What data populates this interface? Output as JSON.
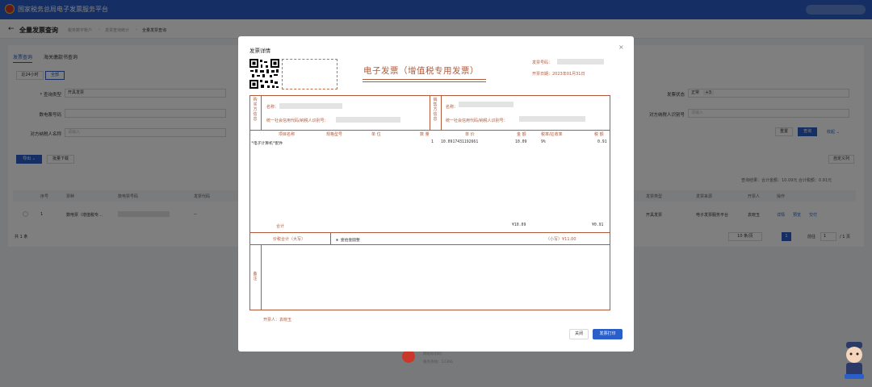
{
  "app": {
    "title": "国家税务总局电子发票服务平台"
  },
  "header": {
    "back_label": "←",
    "page_title": "全量发票查询",
    "breadcrumbs": [
      "税务数字账户",
      "发票查询统计",
      "全量发票查询"
    ]
  },
  "tabs": [
    "发票查询",
    "海关缴款书查询"
  ],
  "time_filters": [
    "近24小时",
    "全部"
  ],
  "filters": {
    "query_type_label": "* 查询类型",
    "query_type_value": "开具发票",
    "invoice_number_label": "数电票号码",
    "buyer_name_label": "对方纳税人名称",
    "buyer_name_placeholder": "请输入",
    "status_label": "发票状态",
    "status_value": "正常",
    "status_extra": "+3",
    "taxpayer_id_label": "对方纳税人识别号",
    "taxpayer_id_placeholder": "请输入",
    "reset_label": "重置",
    "search_label": "查询",
    "collapse_label": "收起 ⌄"
  },
  "toolbar": {
    "export_label": "导出 ⌄",
    "batch_download_label": "批量下载",
    "custom_columns_label": "自定义列"
  },
  "summary": "查询结果：合计金额：10.09元    合计税额：0.91元",
  "table": {
    "headers": [
      "序号",
      "票种",
      "数电票号码",
      "发票代码",
      "发票类型",
      "发票来源",
      "开票人",
      "操作"
    ],
    "rows": [
      {
        "index": "1",
        "type": "数电票（增值税专…",
        "code": "--",
        "invoice_type": "开具发票",
        "source": "电子发票服务平台",
        "issuer": "袁晓玉",
        "actions": [
          "详情",
          "预览",
          "交付"
        ]
      }
    ],
    "total": "共 1 条",
    "page_size": "10 条/页",
    "current_page": "1",
    "goto_label": "前往",
    "goto_value": "1",
    "page_total": "/ 1 页"
  },
  "footer": {
    "line1": "网站标识码：",
    "line2": "服务热线：12366"
  },
  "modal": {
    "title": "发票详情",
    "close_label": "×",
    "invoice_title": "电子发票（增值税专用发票）",
    "invoice_number_label": "发票号码：",
    "issue_date": "开票日期：2023年01月31日",
    "buyer_side": "购买方信息",
    "seller_side": "销售方信息",
    "buyer_name_label": "名称：",
    "buyer_id_label": "统一社会信用代码/纳税人识别号：",
    "seller_name_label": "名称：",
    "seller_id_label": "统一社会信用代码/纳税人识别号：",
    "item_headers": [
      "项目名称",
      "规格型号",
      "单 位",
      "数 量",
      "单 价",
      "金 额",
      "税率/征收率",
      "税 额"
    ],
    "item_row": {
      "name": "*电子计算机*配件",
      "qty": "1",
      "price": "10.0917431192661",
      "amount": "10.09",
      "rate": "9%",
      "tax": "0.91"
    },
    "subtotal_label": "合计",
    "subtotal_amount": "¥10.09",
    "subtotal_tax": "¥0.91",
    "total_label": "价税合计（大写）",
    "total_words": "⊗ 壹拾壹圆整",
    "total_small": "（小写）¥11.00",
    "remarks_label": "备注",
    "issuer_label": "开票人：袁晓玉",
    "close_button": "关闭",
    "print_button": "发票打印"
  },
  "colors": {
    "brand_blue": "#2a5ec8",
    "invoice_brown": "#b05a3a"
  }
}
